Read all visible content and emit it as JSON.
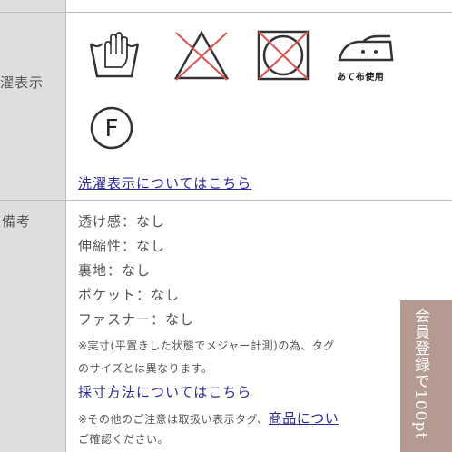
{
  "care_row": {
    "label": "濯表示",
    "icons": [
      "hand-wash-icon",
      "no-bleach-icon",
      "no-tumble-dry-icon",
      "iron-with-cloth-icon",
      "dry-clean-f-icon"
    ],
    "iron_label": "あて布使用",
    "dry_clean_letter": "F",
    "link": "洗濯表示についてはこちら"
  },
  "notes_row": {
    "label": "備考",
    "lines": [
      "透け感：なし",
      "伸縮性：なし",
      "裏地：なし",
      "ポケット：なし",
      "ファスナー：なし"
    ],
    "note1_a": "※実寸(平置きした状態でメジャー計測)の為、タグ",
    "note1_b": "のサイズとは異なります。",
    "measure_link": "採寸方法についてはこちら",
    "note2_prefix": "※その他のご注意は取扱い表示タグ、",
    "note2_link": "商品につい",
    "note2_b": "ご確認ください。"
  },
  "side_tab": {
    "text": "会員登録で100pt"
  },
  "colors": {
    "header_bg": "#dedede",
    "border": "#bdbdbd",
    "link": "#2a2a9a",
    "icon_cross": "#d9534f",
    "side_tab_bg": "#b49a90"
  }
}
